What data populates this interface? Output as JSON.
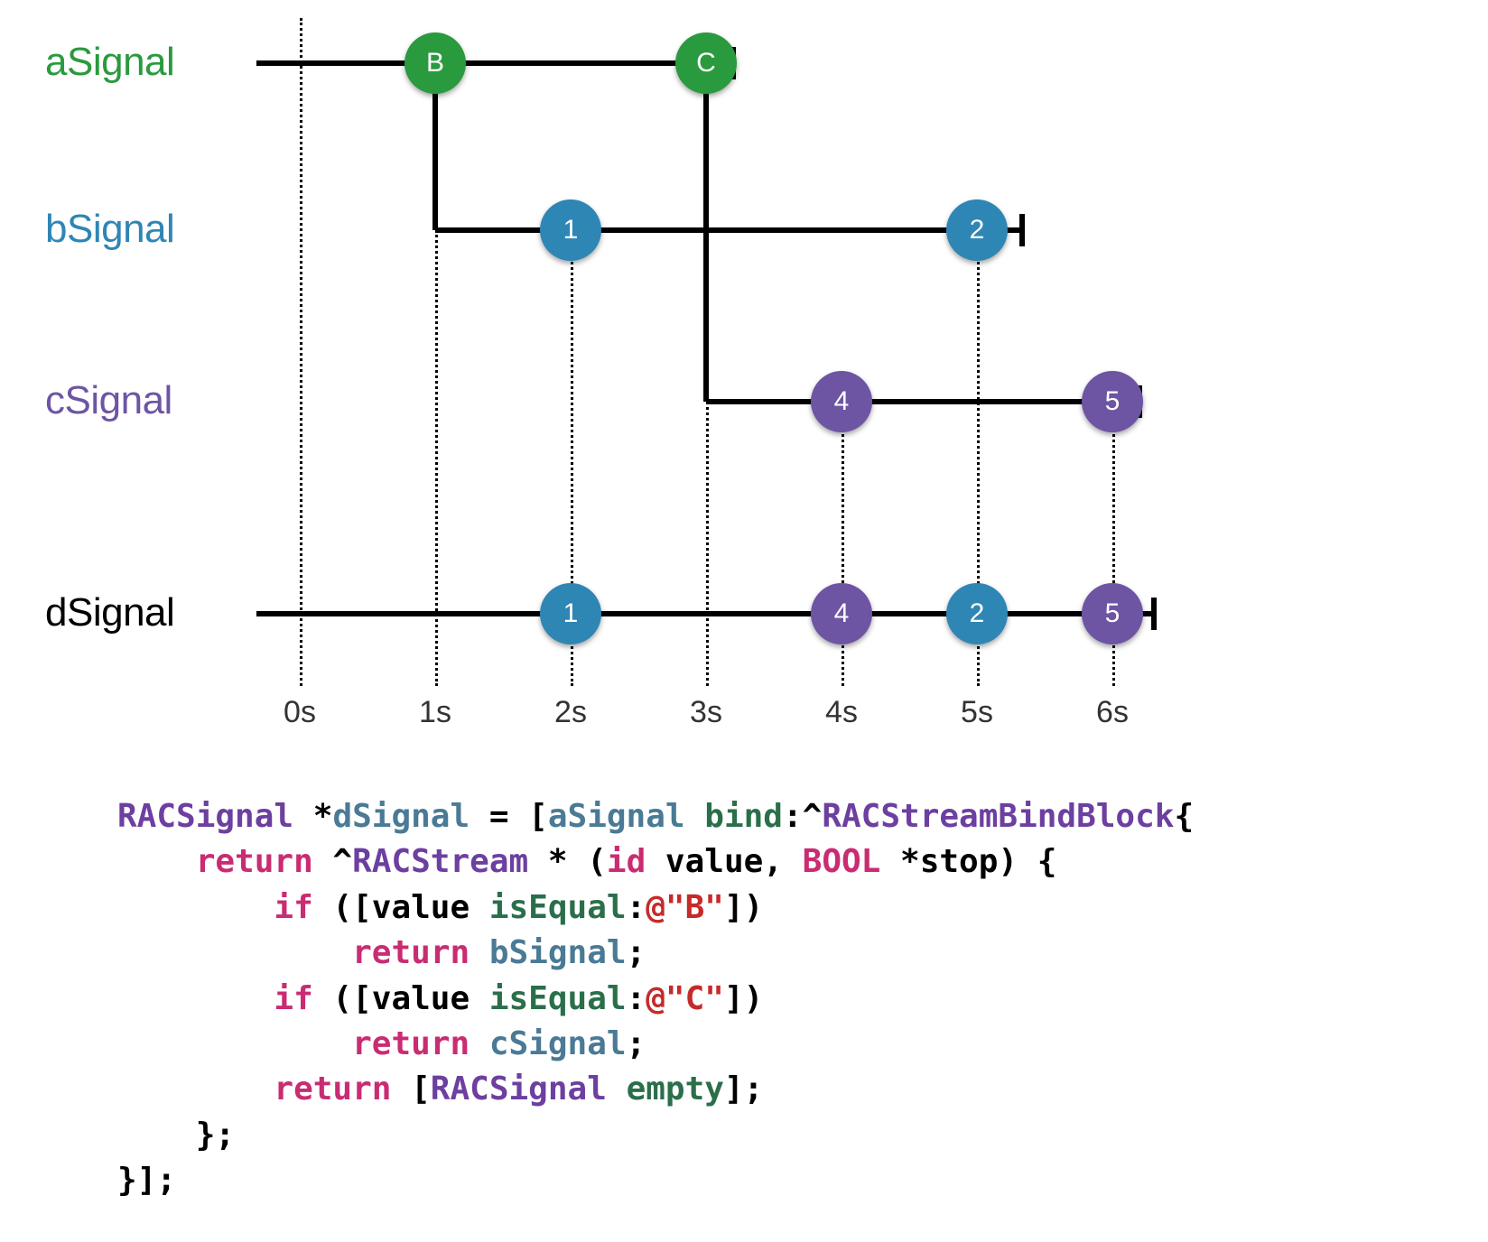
{
  "signals": {
    "a": {
      "label": "aSignal",
      "color": "#2a9a3e"
    },
    "b": {
      "label": "bSignal",
      "color": "#2e86b5"
    },
    "c": {
      "label": "cSignal",
      "color": "#6d55a3"
    },
    "d": {
      "label": "dSignal",
      "color": "#000000"
    }
  },
  "timeLabels": [
    "0s",
    "1s",
    "2s",
    "3s",
    "4s",
    "5s",
    "6s"
  ],
  "events": {
    "a": [
      {
        "label": "B",
        "class": "green"
      },
      {
        "label": "C",
        "class": "green"
      }
    ],
    "b": [
      {
        "label": "1",
        "class": "blue"
      },
      {
        "label": "2",
        "class": "blue"
      }
    ],
    "c": [
      {
        "label": "4",
        "class": "purple"
      },
      {
        "label": "5",
        "class": "purple"
      }
    ],
    "d": [
      {
        "label": "1",
        "class": "blue"
      },
      {
        "label": "4",
        "class": "purple"
      },
      {
        "label": "2",
        "class": "blue"
      },
      {
        "label": "5",
        "class": "purple"
      }
    ]
  },
  "code": {
    "t_type": "RACSignal",
    "t_var": "dSignal",
    "t_eq": " = [",
    "t_src": "aSignal",
    "t_bind": "bind",
    "t_block": ":^",
    "t_bb": "RACStreamBindBlock",
    "t_brace1": "{",
    "t_return": "return",
    "t_stream": "RACStream",
    "t_star": " * (",
    "t_id": "id",
    "t_value": " value, ",
    "t_bool": "BOOL",
    "t_stop": " *stop) {",
    "t_if": "if",
    "t_iseq": "isEqual",
    "t_strB": "@\"B\"",
    "t_strC": "@\"C\"",
    "t_bsig": "bSignal",
    "t_csig": "cSignal",
    "t_empty": "empty",
    "t_racsig": "RACSignal",
    "t_semic": ";",
    "t_close1": "};",
    "t_close2": "}];"
  },
  "chart_data": {
    "type": "timeline",
    "title": "RACSignal bind marble diagram",
    "x_unit": "seconds",
    "x_ticks": [
      0,
      1,
      2,
      3,
      4,
      5,
      6
    ],
    "signals": [
      {
        "name": "aSignal",
        "color": "green",
        "start": 0,
        "events": [
          {
            "time": 1,
            "value": "B"
          },
          {
            "time": 3,
            "value": "C"
          }
        ],
        "complete": 3.2
      },
      {
        "name": "bSignal",
        "color": "blue",
        "start": 1,
        "events": [
          {
            "time": 2,
            "value": 1
          },
          {
            "time": 5,
            "value": 2
          }
        ],
        "complete": 5.3
      },
      {
        "name": "cSignal",
        "color": "purple",
        "start": 3,
        "events": [
          {
            "time": 4,
            "value": 4
          },
          {
            "time": 6,
            "value": 5
          }
        ],
        "complete": 6.2
      },
      {
        "name": "dSignal",
        "color": "mixed",
        "start": 0,
        "events": [
          {
            "time": 2,
            "value": 1,
            "from": "bSignal"
          },
          {
            "time": 4,
            "value": 4,
            "from": "cSignal"
          },
          {
            "time": 5,
            "value": 2,
            "from": "bSignal"
          },
          {
            "time": 6,
            "value": 5,
            "from": "cSignal"
          }
        ],
        "complete": 6.3
      }
    ],
    "derivations": [
      {
        "from": "aSignal",
        "event": "B",
        "spawns": "bSignal"
      },
      {
        "from": "aSignal",
        "event": "C",
        "spawns": "cSignal"
      }
    ]
  }
}
